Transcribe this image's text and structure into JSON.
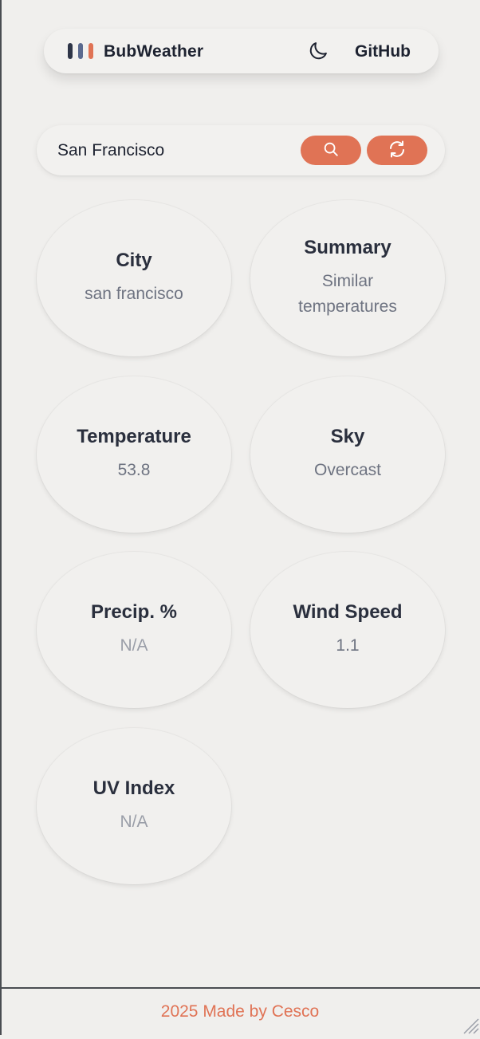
{
  "header": {
    "brand": "BubWeather",
    "theme_icon": "moon-icon",
    "github_label": "GitHub"
  },
  "search": {
    "value": "San Francisco",
    "search_icon": "search-icon",
    "refresh_icon": "refresh-icon"
  },
  "cards": {
    "city": {
      "title": "City",
      "value": "san francisco"
    },
    "summary": {
      "title": "Summary",
      "value": "Similar temperatures"
    },
    "temperature": {
      "title": "Temperature",
      "value": "53.8"
    },
    "sky": {
      "title": "Sky",
      "value": "Overcast"
    },
    "precip": {
      "title": "Precip. %",
      "value": "N/A"
    },
    "wind": {
      "title": "Wind Speed",
      "value": "1.1"
    },
    "uv": {
      "title": "UV Index",
      "value": "N/A"
    }
  },
  "footer": {
    "text": "2025 Made by Cesco"
  },
  "colors": {
    "accent": "#e07355",
    "background": "#f0efed",
    "text": "#2a2f3d",
    "muted": "#6e7381"
  }
}
